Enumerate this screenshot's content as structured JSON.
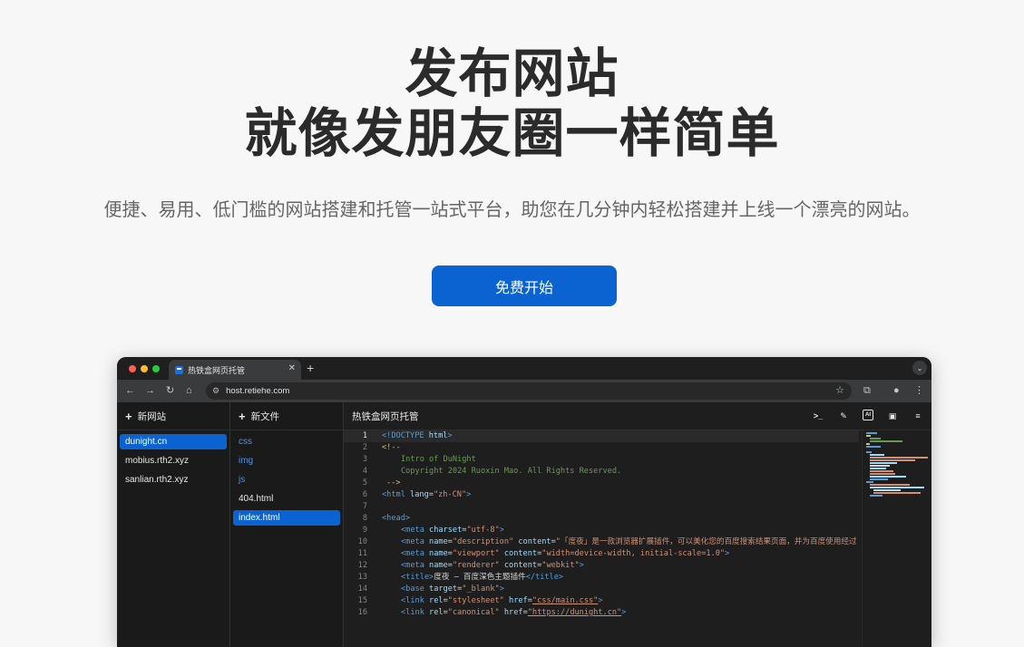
{
  "hero": {
    "title_line1": "发布网站",
    "title_line2": "就像发朋友圈一样简单",
    "subtitle": "便捷、易用、低门槛的网站搭建和托管一站式平台，助您在几分钟内轻松搭建并上线一个漂亮的网站。",
    "cta_label": "免费开始"
  },
  "browser": {
    "tab_title": "热铁盒网页托管",
    "tab_close": "✕",
    "new_tab": "+",
    "url": "host.retiehe.com"
  },
  "sites": {
    "header": "新网站",
    "items": [
      "dunight.cn",
      "mobius.rth2.xyz",
      "sanlian.rth2.xyz"
    ]
  },
  "files": {
    "header": "新文件",
    "items": [
      "css",
      "img",
      "js",
      "404.html",
      "index.html"
    ]
  },
  "editor": {
    "title": "热铁盒网页托管",
    "line_numbers": [
      "1",
      "2",
      "3",
      "4",
      "5",
      "6",
      "7",
      "8",
      "9",
      "10",
      "11",
      "12",
      "13",
      "14",
      "15",
      "16"
    ],
    "code": {
      "l1": {
        "a": "<!DOCTYPE",
        "b": " html",
        "c": ">"
      },
      "l2": {
        "a": "<!--"
      },
      "l3": {
        "a": "Intro of DuNight"
      },
      "l4": {
        "a": "Copyright 2024 Ruoxin Mao. All Rights Reserved."
      },
      "l5": {
        "a": "-->"
      },
      "l6": {
        "a": "<html",
        "b": " lang",
        "c": "=",
        "d": "\"zh-CN\"",
        "e": ">"
      },
      "l8": {
        "a": "<head>"
      },
      "l9": {
        "a": "<meta",
        "b": " charset",
        "c": "=",
        "d": "\"utf-8\"",
        "e": ">"
      },
      "l10": {
        "a": "<meta",
        "b": " name",
        "c": "=",
        "d": "\"description\"",
        "f": " content",
        "g": "=",
        "h": "\"「度夜」是一款浏览器扩展插件，可以美化您的百度搜索结果页面，并为百度使用经过"
      },
      "l11": {
        "a": "<meta",
        "b": " name",
        "c": "=",
        "d": "\"viewport\"",
        "f": " content",
        "g": "=",
        "h": "\"width=device-width, initial-scale=1.0\"",
        "e": ">"
      },
      "l12": {
        "a": "<meta",
        "b": " name",
        "c": "=",
        "d": "\"renderer\"",
        "f": " content",
        "g": "=",
        "h": "\"webkit\"",
        "e": ">"
      },
      "l13": {
        "a": "<title>",
        "t": "度夜 – 百度深色主题插件",
        "e": "</title>"
      },
      "l14": {
        "a": "<base",
        "b": " target",
        "c": "=",
        "d": "\"_blank\"",
        "e": ">"
      },
      "l15": {
        "a": "<link",
        "b": " rel",
        "c": "=",
        "d": "\"stylesheet\"",
        "f": " href",
        "g": "=",
        "h": "\"css/main.css\"",
        "e": ">"
      },
      "l16": {
        "a": "<link",
        "b": " rel",
        "c": "=",
        "d": "\"canonical\"",
        "f": " href",
        "g": "=",
        "h": "\"https://dunight.cn\"",
        "e": ">"
      }
    }
  },
  "colors": {
    "accent": "#0b63d1",
    "background": "#f7f7f7",
    "title": "#2b2b2b"
  }
}
